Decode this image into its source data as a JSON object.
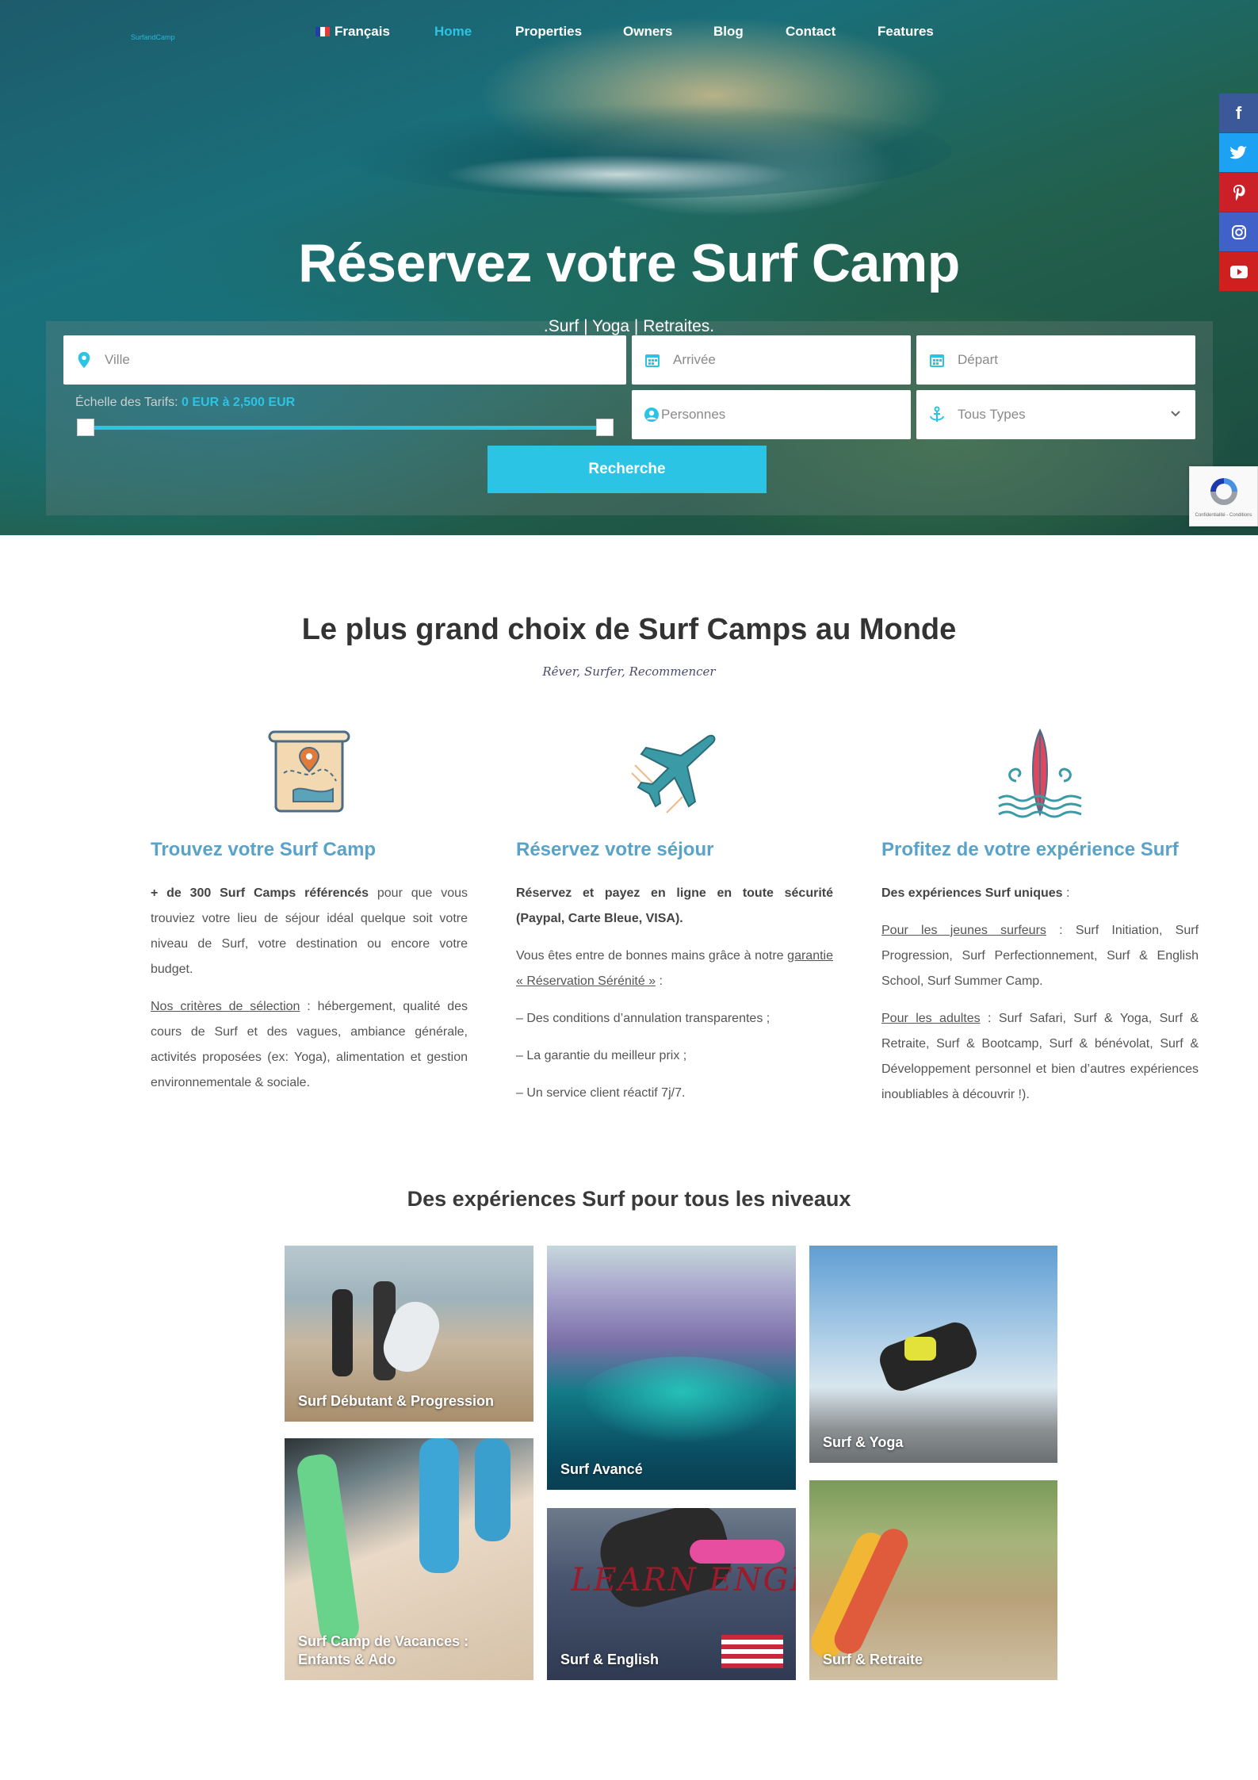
{
  "logo": {
    "text": "SurfandCamp"
  },
  "nav": {
    "items": [
      {
        "label": "Français"
      },
      {
        "label": "Home"
      },
      {
        "label": "Properties"
      },
      {
        "label": "Owners"
      },
      {
        "label": "Blog"
      },
      {
        "label": "Contact"
      },
      {
        "label": "Features"
      }
    ]
  },
  "hero": {
    "title": "Réservez votre Surf Camp",
    "subtitle": ".Surf | Yoga | Retraites."
  },
  "search": {
    "city_placeholder": "Ville",
    "arrival_placeholder": "Arrivée",
    "departure_placeholder": "Départ",
    "persons_placeholder": "Personnes",
    "type_selected": "Tous Types",
    "price_label": "Échelle des Tarifs:",
    "price_range": "0 EUR à 2,500 EUR",
    "price_min_fraction": 0,
    "price_max_fraction": 1,
    "button": "Recherche"
  },
  "social": [
    {
      "icon": "facebook-icon",
      "glyph": "f",
      "color": "#3b5998"
    },
    {
      "icon": "twitter-icon",
      "glyph": "t",
      "color": "#1da1f2"
    },
    {
      "icon": "pinterest-icon",
      "glyph": "p",
      "color": "#cb2027"
    },
    {
      "icon": "instagram-icon",
      "glyph": "◎",
      "color": "#3f61c8"
    },
    {
      "icon": "youtube-icon",
      "glyph": "▶",
      "color": "#cd201f"
    }
  ],
  "recaptcha": {
    "text": "Confidentialité - Conditions"
  },
  "section1": {
    "title": "Le plus grand choix de Surf Camps au Monde",
    "script": "Rêver, Surfer, Recommencer",
    "cols": [
      {
        "title": "Trouvez votre Surf Camp",
        "p1_bold": "+ de 300 Surf Camps référencés",
        "p1_rest": " pour que vous trouviez votre lieu de séjour idéal quelque soit votre niveau de Surf, votre destination ou encore votre budget.",
        "p2_link": "Nos critères de sélection",
        "p2_rest": " : hébergement, qualité des cours de Surf et des vagues, ambiance générale, activités proposées (ex: Yoga), alimentation et gestion environnementale & sociale."
      },
      {
        "title": "Réservez votre séjour",
        "p1_bold": "Réservez et payez en ligne en toute sécurité (Paypal, Carte Bleue, VISA).",
        "p2_pre": "Vous êtes entre de bonnes mains grâce à notre ",
        "p2_link": "garantie « Réservation Sérénité »",
        "p2_post": " :",
        "l1": "– Des conditions d’annulation transparentes ;",
        "l2": "–  La garantie du meilleur prix ;",
        "l3": "– Un service client réactif 7j/7."
      },
      {
        "title": "Profitez de votre expérience Surf",
        "p1_bold": "Des expériences Surf uniques",
        "p1_rest": " :",
        "p2_link": "Pour les jeunes surfeurs",
        "p2_rest": " : Surf Initiation, Surf Progression, Surf Perfectionnement, Surf & English School, Surf  Summer Camp.",
        "p3_link": "Pour les adultes",
        "p3_rest": " :  Surf Safari, Surf & Yoga, Surf & Retraite, Surf & Bootcamp, Surf & bénévolat, Surf & Développement personnel et bien d’autres expériences inoubliables à découvrir !)."
      }
    ]
  },
  "section2": {
    "title": "Des expériences Surf pour tous les niveaux",
    "tiles": [
      {
        "label": "Surf Débutant & Progression"
      },
      {
        "label": "Surf Camp de Vacances : Enfants & Ado"
      },
      {
        "label": "Surf Avancé"
      },
      {
        "label": "Surf & English",
        "overlay": "LEARN ENGLISH"
      },
      {
        "label": "Surf & Yoga"
      },
      {
        "label": "Surf & Retraite"
      }
    ]
  }
}
